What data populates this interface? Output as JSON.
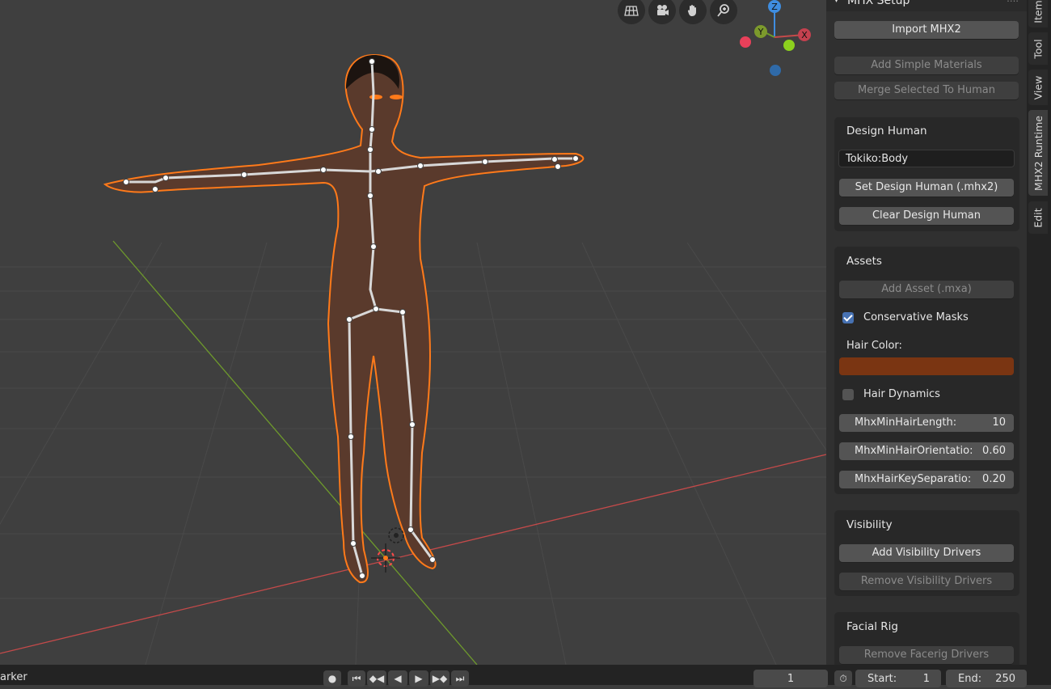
{
  "sidebar": {
    "panel_title": "MHX Setup",
    "panel_menu": "::::",
    "import_button": "Import MHX2",
    "add_materials_button": "Add Simple Materials",
    "merge_button": "Merge Selected To Human",
    "design_human": {
      "title": "Design Human",
      "field_value": "Tokiko:Body",
      "set_button": "Set Design Human (.mhx2)",
      "clear_button": "Clear Design Human"
    },
    "assets": {
      "title": "Assets",
      "add_asset_button": "Add Asset (.mxa)",
      "conservative_masks_label": "Conservative Masks",
      "conservative_masks_checked": true,
      "hair_color_label": "Hair Color:",
      "hair_color": "#7a3512",
      "hair_dynamics_label": "Hair Dynamics",
      "hair_dynamics_checked": false,
      "fields": [
        {
          "label": "MhxMinHairLength:",
          "value": "10"
        },
        {
          "label": "MhxMinHairOrientatio:",
          "value": "0.60"
        },
        {
          "label": "MhxHairKeySeparatio:",
          "value": "0.20"
        }
      ]
    },
    "visibility": {
      "title": "Visibility",
      "add_button": "Add Visibility Drivers",
      "remove_button": "Remove Visibility Drivers"
    },
    "facial_rig": {
      "title": "Facial Rig",
      "remove_button": "Remove Facerig Drivers"
    }
  },
  "tabs": [
    "Item",
    "Tool",
    "View",
    "MHX2 Runtime",
    "Edit"
  ],
  "active_tab": "MHX2 Runtime",
  "gizmo": {
    "z": "Z",
    "y": "Y",
    "x": "X"
  },
  "nav_icons": [
    "grid-icon",
    "camera-icon",
    "hand-icon",
    "zoom-icon"
  ],
  "timeline": {
    "marker_label": "arker",
    "current_frame": "1",
    "start_label": "Start:",
    "start_value": "1",
    "end_label": "End:",
    "end_value": "250"
  },
  "colors": {
    "selection_outline": "#ff7a1a",
    "x_axis": "#c44a4a",
    "y_axis": "#6e9a2c",
    "accent": "#4772b3"
  }
}
